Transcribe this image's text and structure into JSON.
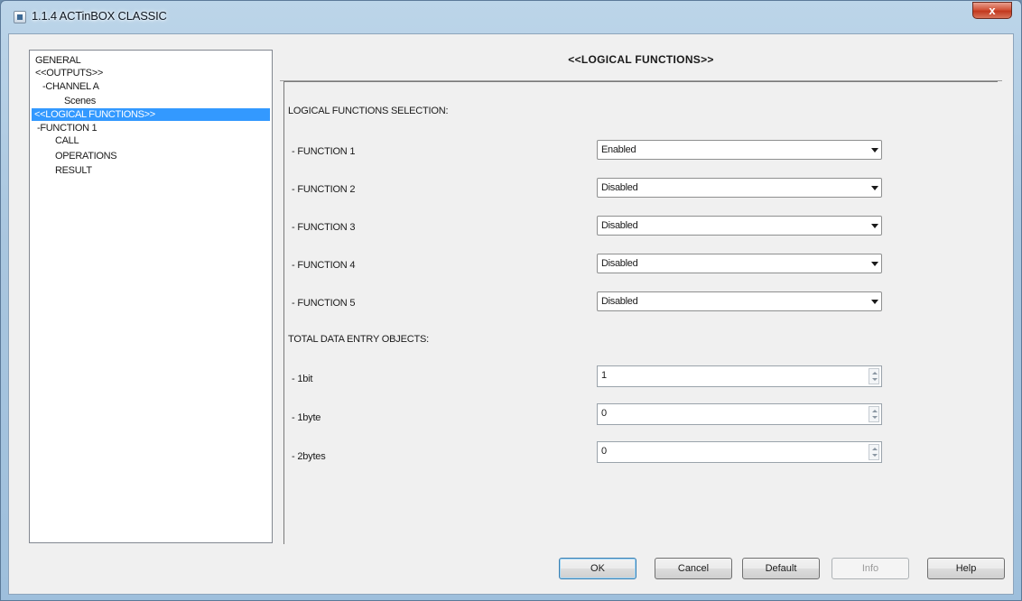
{
  "window": {
    "title": "1.1.4 ACTinBOX CLASSIC",
    "close_label": "x"
  },
  "tree": {
    "items": [
      {
        "label": "GENERAL"
      },
      {
        "label": "<<OUTPUTS>>"
      },
      {
        "label": "-CHANNEL A"
      },
      {
        "label": "Scenes"
      },
      {
        "label": "<<LOGICAL FUNCTIONS>>",
        "selected": true
      },
      {
        "label": "-FUNCTION 1"
      },
      {
        "label": "CALL"
      },
      {
        "label": "OPERATIONS"
      },
      {
        "label": "RESULT"
      }
    ]
  },
  "panel": {
    "title": "<<LOGICAL FUNCTIONS>>",
    "selection_heading": "LOGICAL FUNCTIONS SELECTION:",
    "functions": [
      {
        "label": "- FUNCTION 1",
        "value": "Enabled"
      },
      {
        "label": "- FUNCTION 2",
        "value": "Disabled"
      },
      {
        "label": "- FUNCTION 3",
        "value": "Disabled"
      },
      {
        "label": "- FUNCTION 4",
        "value": "Disabled"
      },
      {
        "label": "- FUNCTION 5",
        "value": "Disabled"
      }
    ],
    "objects_heading": "TOTAL DATA ENTRY OBJECTS:",
    "objects": [
      {
        "label": "- 1bit",
        "value": "1"
      },
      {
        "label": "- 1byte",
        "value": "0"
      },
      {
        "label": "- 2bytes",
        "value": "0"
      }
    ]
  },
  "buttons": {
    "ok": "OK",
    "cancel": "Cancel",
    "default": "Default",
    "info": "Info",
    "help": "Help"
  }
}
